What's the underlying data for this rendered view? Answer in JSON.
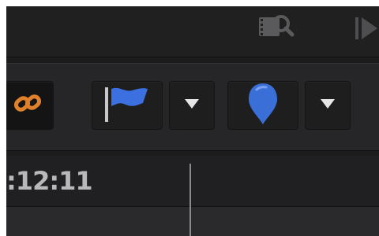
{
  "topbar": {
    "icons": [
      "clip-search-icon",
      "play-icon"
    ]
  },
  "toolbar": {
    "buttons": [
      {
        "icon": "link-icon",
        "color": "#e0802a"
      },
      {
        "icon": "flag-icon",
        "color": "#3c6fe0"
      },
      {
        "icon": "dropdown-arrow-icon"
      },
      {
        "icon": "marker-icon",
        "color": "#3b6fd8"
      },
      {
        "icon": "dropdown-arrow-icon"
      }
    ]
  },
  "timeline": {
    "timecode": ":12:11"
  }
}
